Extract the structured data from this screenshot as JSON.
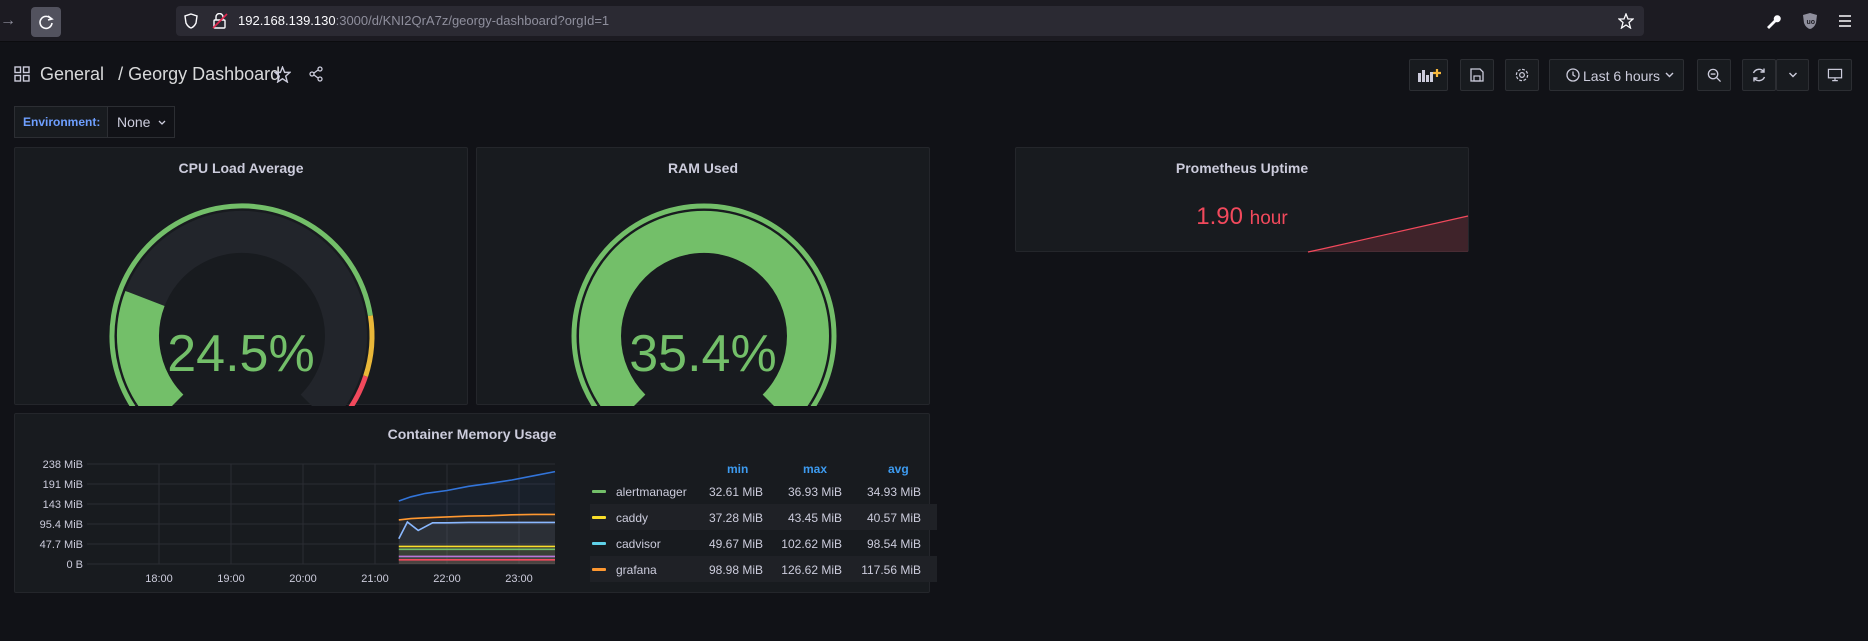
{
  "browser": {
    "url_host": "192.168.139.130",
    "url_rest": ":3000/d/KNI2QrA7z/georgy-dashboard?orgId=1"
  },
  "nav": {
    "crumb_folder": "General",
    "crumb_separator": "/",
    "crumb_dashboard": "Georgy Dashboard",
    "time_range": "Last 6 hours"
  },
  "variables": {
    "label": "Environment:",
    "value": "None"
  },
  "panels": {
    "cpu": {
      "title": "CPU Load Average",
      "value": "24.5%",
      "fraction": 0.245
    },
    "ram": {
      "title": "RAM Used",
      "value": "35.4%",
      "fraction": 0.354
    },
    "uptime": {
      "title": "Prometheus Uptime",
      "value": "1.90",
      "unit": "hour"
    },
    "memory": {
      "title": "Container Memory Usage",
      "legend_headers": [
        "min",
        "max",
        "avg"
      ],
      "legend": [
        {
          "name": "alertmanager",
          "min": "32.61 MiB",
          "max": "36.93 MiB",
          "avg": "34.93 MiB",
          "color": "#73bf69"
        },
        {
          "name": "caddy",
          "min": "37.28 MiB",
          "max": "43.45 MiB",
          "avg": "40.57 MiB",
          "color": "#fade2a"
        },
        {
          "name": "cadvisor",
          "min": "49.67 MiB",
          "max": "102.62 MiB",
          "avg": "98.54 MiB",
          "color": "#5794f2"
        },
        {
          "name": "grafana",
          "min": "98.98 MiB",
          "max": "126.62 MiB",
          "avg": "117.56 MiB",
          "color": "#ff9830"
        }
      ]
    }
  },
  "chart_data": {
    "type": "line",
    "title": "Container Memory Usage",
    "ylim": [
      0,
      238
    ],
    "y_ticks": [
      "238 MiB",
      "191 MiB",
      "143 MiB",
      "95.4 MiB",
      "47.7 MiB",
      "0 B"
    ],
    "x_ticks": [
      "18:00",
      "19:00",
      "20:00",
      "21:00",
      "22:00",
      "23:00"
    ],
    "series": [
      {
        "color": "#3274d9",
        "x": [
          21.33,
          21.5,
          21.7,
          22.0,
          22.3,
          22.6,
          22.9,
          23.2,
          23.5
        ],
        "y": [
          150,
          160,
          168,
          175,
          185,
          192,
          200,
          210,
          220
        ]
      },
      {
        "color": "#ff9830",
        "x": [
          21.33,
          21.5,
          21.7,
          22.0,
          22.3,
          22.6,
          22.9,
          23.2,
          23.5
        ],
        "y": [
          105,
          108,
          110,
          112,
          114,
          115,
          117,
          118,
          118
        ]
      },
      {
        "color": "#8ab8ff",
        "x": [
          21.33,
          21.45,
          21.6,
          21.8,
          22.0,
          22.3,
          22.6,
          22.9,
          23.2,
          23.5
        ],
        "y": [
          60,
          100,
          80,
          98,
          98,
          99,
          99,
          99,
          99,
          99
        ]
      },
      {
        "color": "#fade2a",
        "x": [
          21.33,
          22.0,
          23.0,
          23.5
        ],
        "y": [
          42,
          42,
          42,
          42
        ]
      },
      {
        "color": "#73bf69",
        "x": [
          21.33,
          22.0,
          23.0,
          23.5
        ],
        "y": [
          35,
          35,
          35,
          35
        ]
      },
      {
        "color": "#b877d9",
        "x": [
          21.33,
          22.0,
          23.0,
          23.5
        ],
        "y": [
          18,
          18,
          18,
          18
        ]
      },
      {
        "color": "#f2495c",
        "x": [
          21.33,
          22.0,
          23.0,
          23.5
        ],
        "y": [
          10,
          10,
          10,
          10
        ]
      }
    ]
  }
}
